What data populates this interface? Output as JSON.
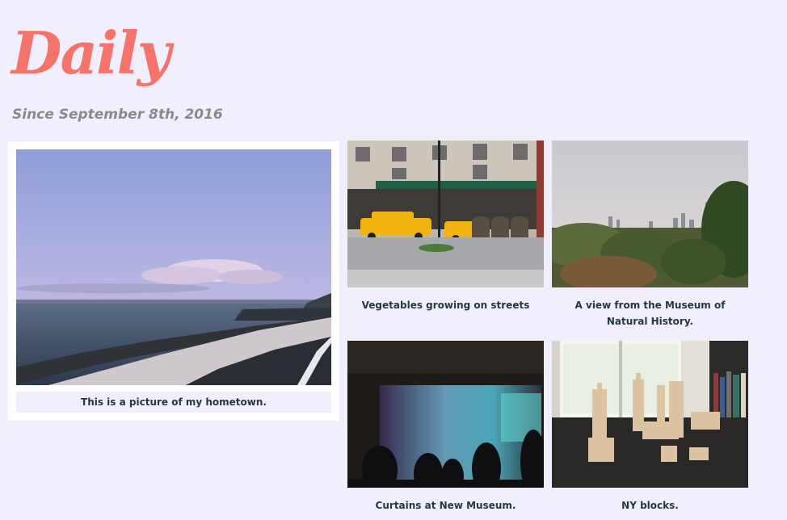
{
  "header": {
    "title": "Daily",
    "subtitle": "Since September 8th, 2016"
  },
  "colors": {
    "background": "#f1eefe",
    "title": "#f4736b",
    "subtitle": "#8a8a8a",
    "caption": "#233a3c",
    "card": "#ffffff"
  },
  "posts": [
    {
      "caption": "This is a picture of my hometown.",
      "photo": "seawall-sunset-photo"
    },
    {
      "caption": "Vegetables growing on streets",
      "photo": "street-taxi-photo"
    },
    {
      "caption": "A view from the Museum of Natural History.",
      "photo": "park-skyline-photo"
    },
    {
      "caption": "Curtains at New Museum.",
      "photo": "gallery-curtains-photo"
    },
    {
      "caption": "NY blocks.",
      "photo": "wooden-blocks-photo"
    }
  ]
}
